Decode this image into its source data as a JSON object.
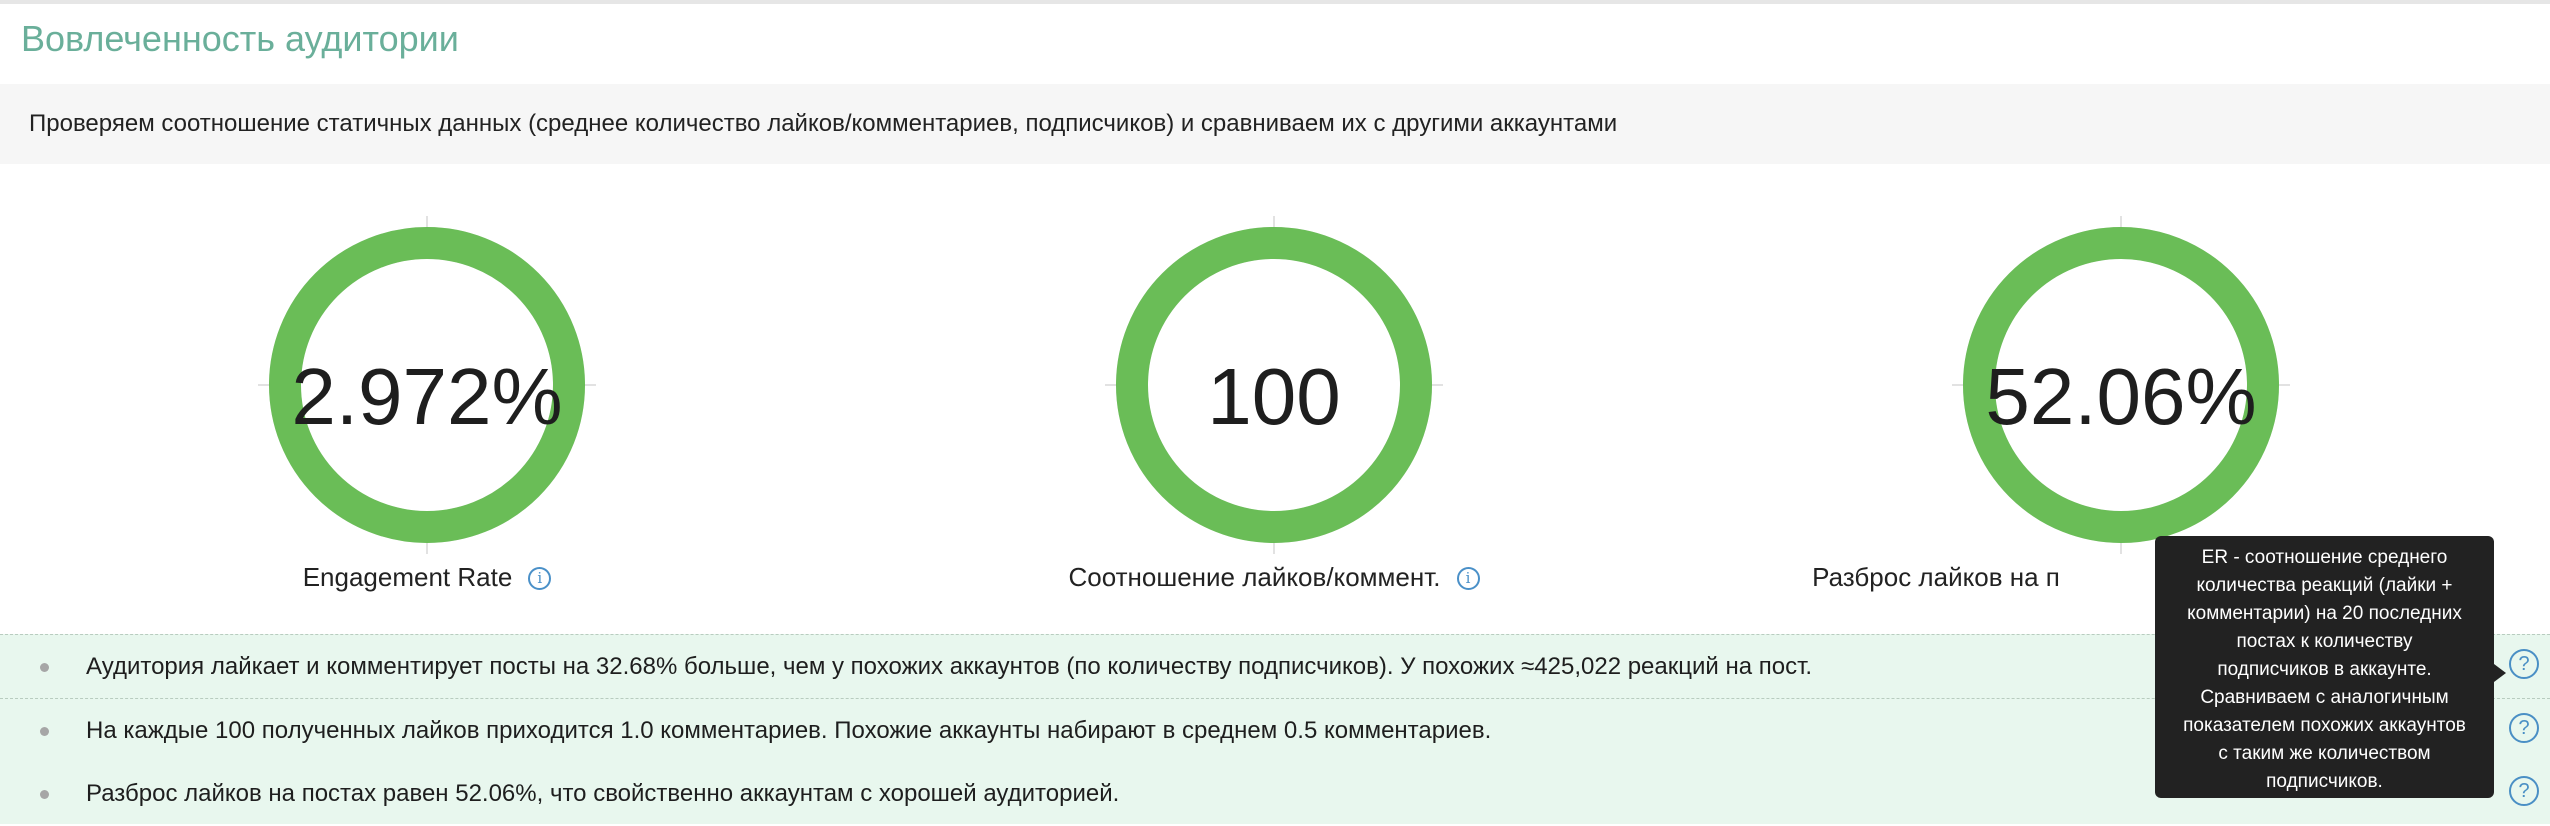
{
  "section": {
    "title": "Вовлеченность аудитории",
    "description": "Проверяем соотношение статичных данных (среднее количество лайков/комментариев, подписчиков) и сравниваем их с другими аккаунтами"
  },
  "metrics": [
    {
      "value": "2.972%",
      "label": "Engagement Rate",
      "fraction": 1.0
    },
    {
      "value": "100",
      "label": "Соотношение лайков/коммент.",
      "fraction": 1.0
    },
    {
      "value": "52.06%",
      "label": "Разброс лайков на п",
      "fraction": 1.0
    }
  ],
  "colors": {
    "ring": "#6abd57",
    "ring_track": "#e3e3e3",
    "title": "#6aaf9a",
    "facts_bg": "#e8f7ee",
    "info": "#4a90c8"
  },
  "icons": {
    "info": "info-icon",
    "help": "question-circle-icon"
  },
  "info_glyph": "i",
  "help_glyph": "?",
  "facts": [
    {
      "text": "Аудитория лайкает и комментирует посты на 32.68% больше, чем у похожих аккаунтов (по количеству подписчиков). У похожих ≈425,022 реакций на пост."
    },
    {
      "text": "На каждые 100 полученных лайков приходится 1.0 комментариев. Похожие аккаунты набирают в среднем 0.5 комментариев."
    },
    {
      "text": "Разброс лайков на постах равен 52.06%, что свойственно аккаунтам с хорошей аудиторией."
    }
  ],
  "tooltip": {
    "lines": [
      "ER - соотношение среднего",
      "количества реакций (лайки +",
      "комментарии) на 20 последних",
      "постах к количеству",
      "подписчиков в аккаунте.",
      "Сравниваем с аналогичным",
      "показателем похожих аккаунтов",
      "с таким же количеством",
      "подписчиков."
    ]
  }
}
